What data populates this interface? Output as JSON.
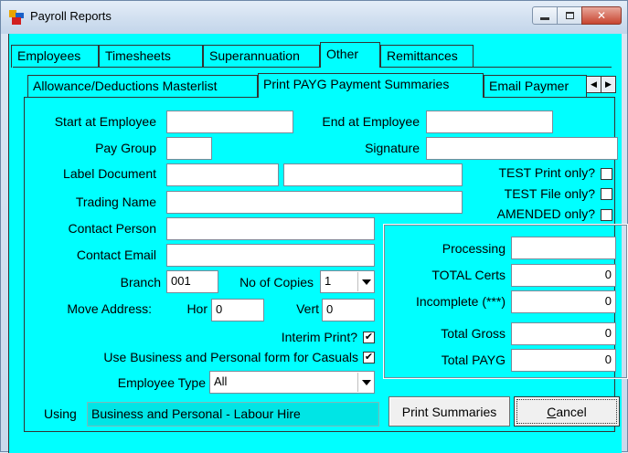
{
  "window": {
    "title": "Payroll Reports"
  },
  "tabs_main": [
    "Employees",
    "Timesheets",
    "Superannuation",
    "Other",
    "Remittances"
  ],
  "tabs_sub": [
    "Allowance/Deductions Masterlist",
    "Print PAYG Payment Summaries",
    "Email Paymer"
  ],
  "form": {
    "start_employee_label": "Start at Employee",
    "start_employee_value": "",
    "end_employee_label": "End at Employee",
    "end_employee_value": "",
    "pay_group_label": "Pay Group",
    "pay_group_value": "",
    "signature_label": "Signature",
    "signature_value": "",
    "label_document_label": "Label Document",
    "label_document_value1": "",
    "label_document_value2": "",
    "test_print_label": "TEST Print only?",
    "test_print_checked": "",
    "test_file_label": "TEST File only?",
    "test_file_checked": "",
    "amended_label": "AMENDED only?",
    "amended_checked": "",
    "trading_name_label": "Trading Name",
    "trading_name_value": "",
    "contact_person_label": "Contact Person",
    "contact_person_value": "",
    "contact_email_label": "Contact Email",
    "contact_email_value": "",
    "branch_label": "Branch",
    "branch_value": "001",
    "copies_label": "No of Copies",
    "copies_value": "1",
    "move_address_label": "Move Address:",
    "hor_label": "Hor",
    "hor_value": "0",
    "vert_label": "Vert",
    "vert_value": "0",
    "interim_label": "Interim Print?",
    "interim_checked": "✔",
    "business_form_label": "Use Business and Personal form for Casuals",
    "business_form_checked": "✔",
    "employee_type_label": "Employee Type",
    "employee_type_value": "All",
    "using_label": "Using",
    "using_value": "Business and Personal - Labour Hire"
  },
  "summary": {
    "processing_label": "Processing",
    "processing_value": "",
    "total_certs_label": "TOTAL Certs",
    "total_certs_value": "0",
    "incomplete_label": "Incomplete (***)",
    "incomplete_value": "0",
    "total_gross_label": "Total Gross",
    "total_gross_value": "0",
    "total_payg_label": "Total PAYG",
    "total_payg_value": "0"
  },
  "buttons": {
    "print_summaries": "Print Summaries",
    "cancel_prefix": "C",
    "cancel_rest": "ancel"
  }
}
